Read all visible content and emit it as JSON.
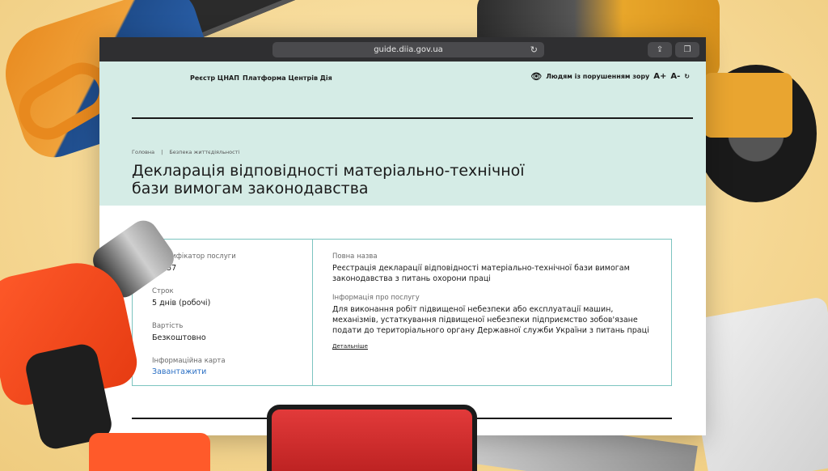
{
  "browser": {
    "url": "guide.diia.gov.ua"
  },
  "nav": {
    "items": [
      "Реєстр ЦНАП",
      "Платформа Центрів Дія"
    ],
    "accessibility_label": "Людям із порушенням зору",
    "font_increase": "A+",
    "font_decrease": "A-"
  },
  "breadcrumb": {
    "home": "Головна",
    "separator": "|",
    "section": "Безпека життєдіяльності"
  },
  "page": {
    "title_line1": "Декларація відповідності матеріально-технічної",
    "title_line2": "бази вимогам законодавства"
  },
  "service": {
    "id_label": "Ідентифікатор послуги",
    "id_value": "00757",
    "term_label": "Строк",
    "term_value": "5 днів (робочі)",
    "cost_label": "Вартість",
    "cost_value": "Безкоштовно",
    "card_label": "Інформаційна карта",
    "card_link": "Завантажити",
    "full_name_label": "Повна назва",
    "full_name_line1": "Реєстрація декларації відповідності матеріально-технічної бази вимогам",
    "full_name_line2": "законодавства з питань охорони праці",
    "info_label": "Інформація про послугу",
    "info_line1": "Для виконання робіт підвищеної небезпеки або експлуатації машин,",
    "info_line2": "механізмів, устаткування підвищеної небезпеки підприємство зобов'язане",
    "info_line3": "подати до територіального органу Державної служби України з питань праці",
    "details_link": "Детальніше"
  },
  "colors": {
    "hero_bg": "#d5ece6",
    "card_border": "#7cc4c0",
    "link": "#2a6fc4",
    "backdrop": "#f6dca0"
  }
}
